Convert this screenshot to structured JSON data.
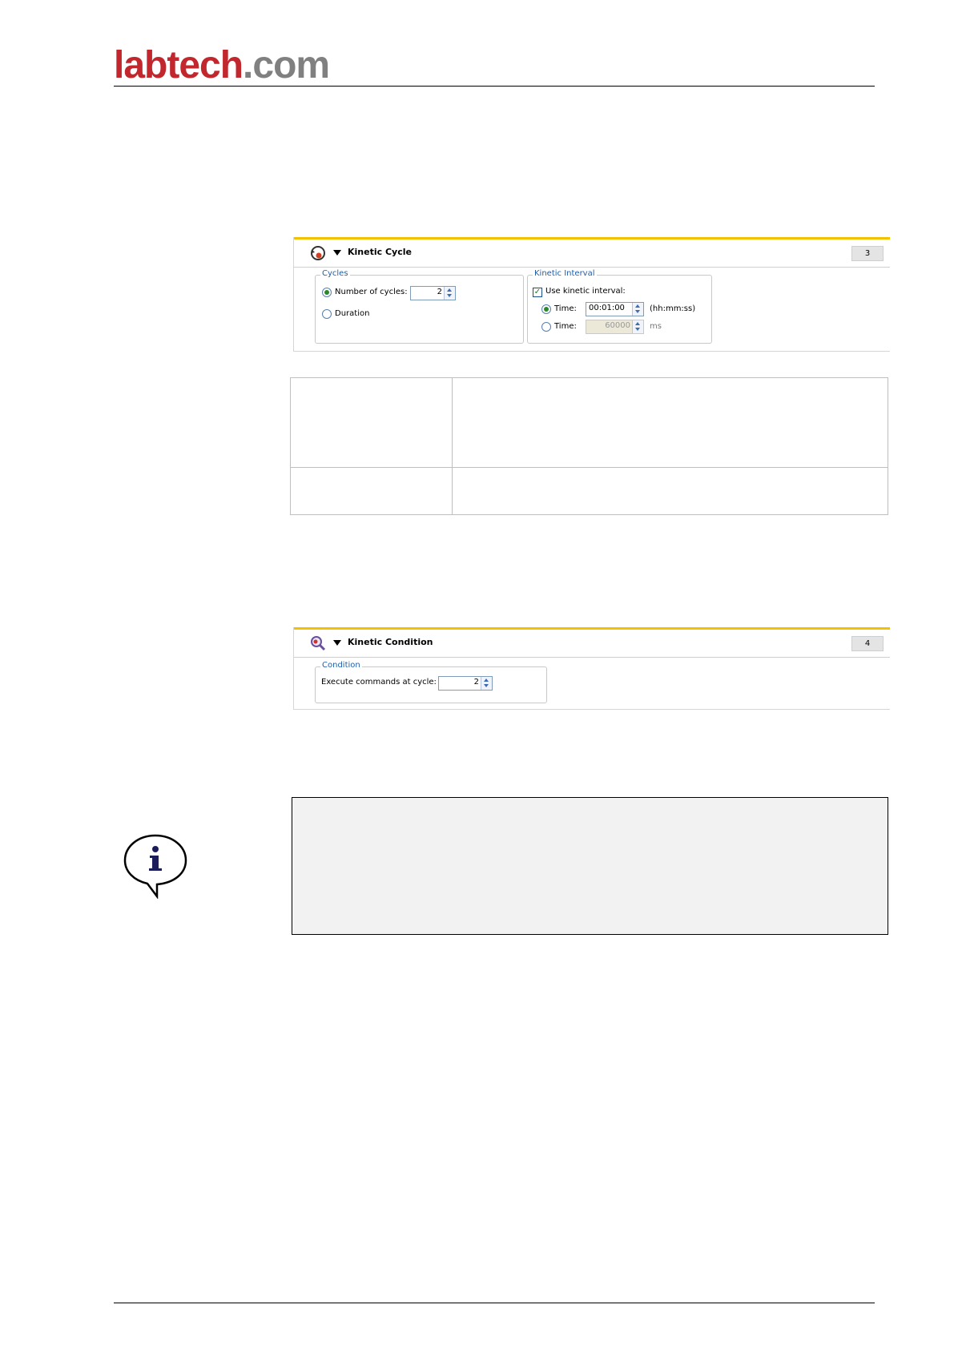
{
  "header": {
    "logo_primary": "labtech",
    "logo_secondary": ".com"
  },
  "kinetic_cycle": {
    "title": "Kinetic Cycle",
    "step_number": "3",
    "cycles": {
      "legend": "Cycles",
      "number_of_cycles_label": "Number of cycles:",
      "number_of_cycles_value": "2",
      "duration_label": "Duration",
      "selected": "number_of_cycles"
    },
    "kinetic_interval": {
      "legend": "Kinetic Interval",
      "use_interval_label": "Use kinetic interval:",
      "use_interval_checked": true,
      "time_label_1": "Time:",
      "time_value_1": "00:01:00",
      "time_unit_1": "(hh:mm:ss)",
      "time_label_2": "Time:",
      "time_value_2": "60000",
      "time_unit_2": "ms"
    }
  },
  "kinetic_condition": {
    "title": "Kinetic Condition",
    "step_number": "4",
    "condition": {
      "legend": "Condition",
      "execute_label": "Execute commands at cycle:",
      "execute_value": "2"
    }
  },
  "info_icon": "info-speech-bubble-icon"
}
